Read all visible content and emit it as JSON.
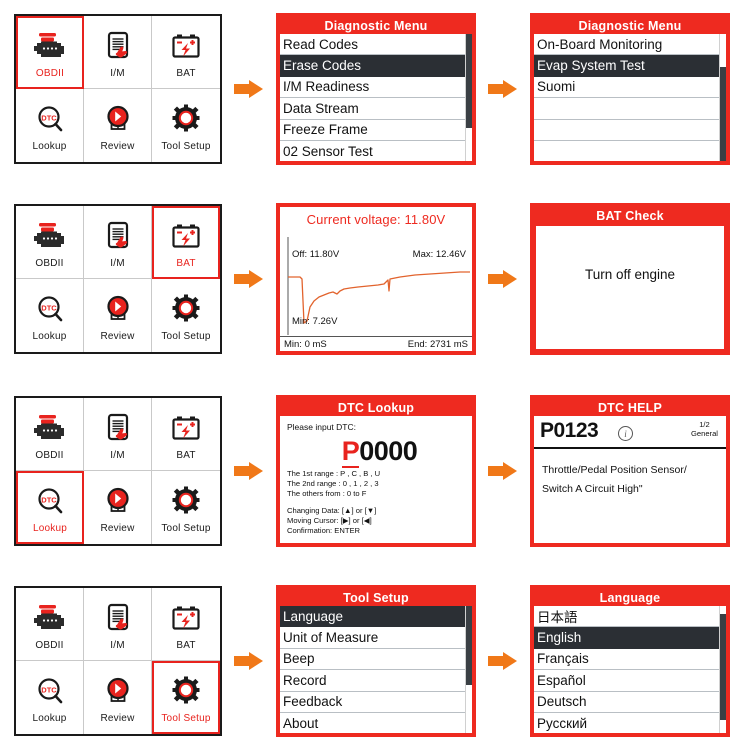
{
  "device_menu": {
    "items": [
      {
        "id": "obdii",
        "label": "OBDII",
        "icon": "engine-icon"
      },
      {
        "id": "im",
        "label": "I/M",
        "icon": "tablet-hand-icon"
      },
      {
        "id": "bat",
        "label": "BAT",
        "icon": "battery-icon"
      },
      {
        "id": "lookup",
        "label": "Lookup",
        "icon": "dtc-magnifier-icon"
      },
      {
        "id": "review",
        "label": "Review",
        "icon": "play-circle-icon"
      },
      {
        "id": "tool_setup",
        "label": "Tool Setup",
        "icon": "gear-icon"
      }
    ],
    "selected_by_row": [
      "obdii",
      "bat",
      "lookup",
      "tool_setup"
    ]
  },
  "colors": {
    "brand_red": "#ee2a20",
    "accent_orange": "#f07818",
    "list_selected_bg": "#2b2f34",
    "graph_line": "#e2632d"
  },
  "rows": [
    {
      "id": "row-diagnostic",
      "screen_a": {
        "title": "Diagnostic Menu",
        "rows": [
          {
            "label": "Read Codes",
            "selected": false
          },
          {
            "label": "Erase Codes",
            "selected": true
          },
          {
            "label": "I/M Readiness",
            "selected": false
          },
          {
            "label": "Data Stream",
            "selected": false
          },
          {
            "label": "Freeze Frame",
            "selected": false
          },
          {
            "label": "02 Sensor Test",
            "selected": false
          }
        ],
        "scroll": {
          "top_pct": 0,
          "height_pct": 74
        }
      },
      "screen_b": {
        "title": "Diagnostic Menu",
        "rows": [
          {
            "label": "On-Board Monitoring",
            "selected": false
          },
          {
            "label": "Evap System Test",
            "selected": true
          },
          {
            "label": "Suomi",
            "selected": false
          },
          {
            "label": "",
            "selected": false
          },
          {
            "label": "",
            "selected": false
          },
          {
            "label": "",
            "selected": false
          }
        ],
        "scroll": {
          "top_pct": 26,
          "height_pct": 74
        }
      }
    },
    {
      "id": "row-bat",
      "screen_a": {
        "header": "Current voltage: 11.80V",
        "labels": {
          "off": "Off: 11.80V",
          "max": "Max: 12.46V",
          "min": "Min: 7.26V",
          "foot_left": "Min: 0 mS",
          "foot_right": "End: 2731 mS"
        }
      },
      "screen_b": {
        "title": "BAT Check",
        "message": "Turn off engine"
      }
    },
    {
      "id": "row-dtc",
      "screen_a": {
        "title": "DTC Lookup",
        "prompt": "Please input DTC:",
        "code_first": "P",
        "code_rest": "0000",
        "rules": [
          "The 1st range : P , C , B , U",
          "The 2nd range : 0 , 1 , 2 , 3",
          "The others from : 0 to F"
        ],
        "keys": [
          "Changing Data: [▲] or [▼]",
          "Moving Cursor:  [▶] or  [◀]",
          "Confirmation:  ENTER"
        ]
      },
      "screen_b": {
        "title": "DTC HELP",
        "code": "P0123",
        "info_glyph": "i",
        "page": "1/2",
        "scope": "General",
        "description_lines": [
          "Throttle/Pedal Position Sensor/",
          "Switch A Circuit High\""
        ]
      }
    },
    {
      "id": "row-setup",
      "screen_a": {
        "title": "Tool Setup",
        "rows": [
          {
            "label": "Language",
            "selected": true
          },
          {
            "label": "Unit of Measure",
            "selected": false
          },
          {
            "label": "Beep",
            "selected": false
          },
          {
            "label": "Record",
            "selected": false
          },
          {
            "label": "Feedback",
            "selected": false
          },
          {
            "label": "About",
            "selected": false
          }
        ],
        "scroll": {
          "top_pct": 0,
          "height_pct": 62
        }
      },
      "screen_b": {
        "title": "Language",
        "rows": [
          {
            "label": "日本語",
            "selected": false
          },
          {
            "label": "English",
            "selected": true
          },
          {
            "label": "Français",
            "selected": false
          },
          {
            "label": "Español",
            "selected": false
          },
          {
            "label": "Deutsch",
            "selected": false
          },
          {
            "label": "Русский",
            "selected": false
          }
        ],
        "scroll": {
          "top_pct": 6,
          "height_pct": 84
        }
      }
    }
  ]
}
